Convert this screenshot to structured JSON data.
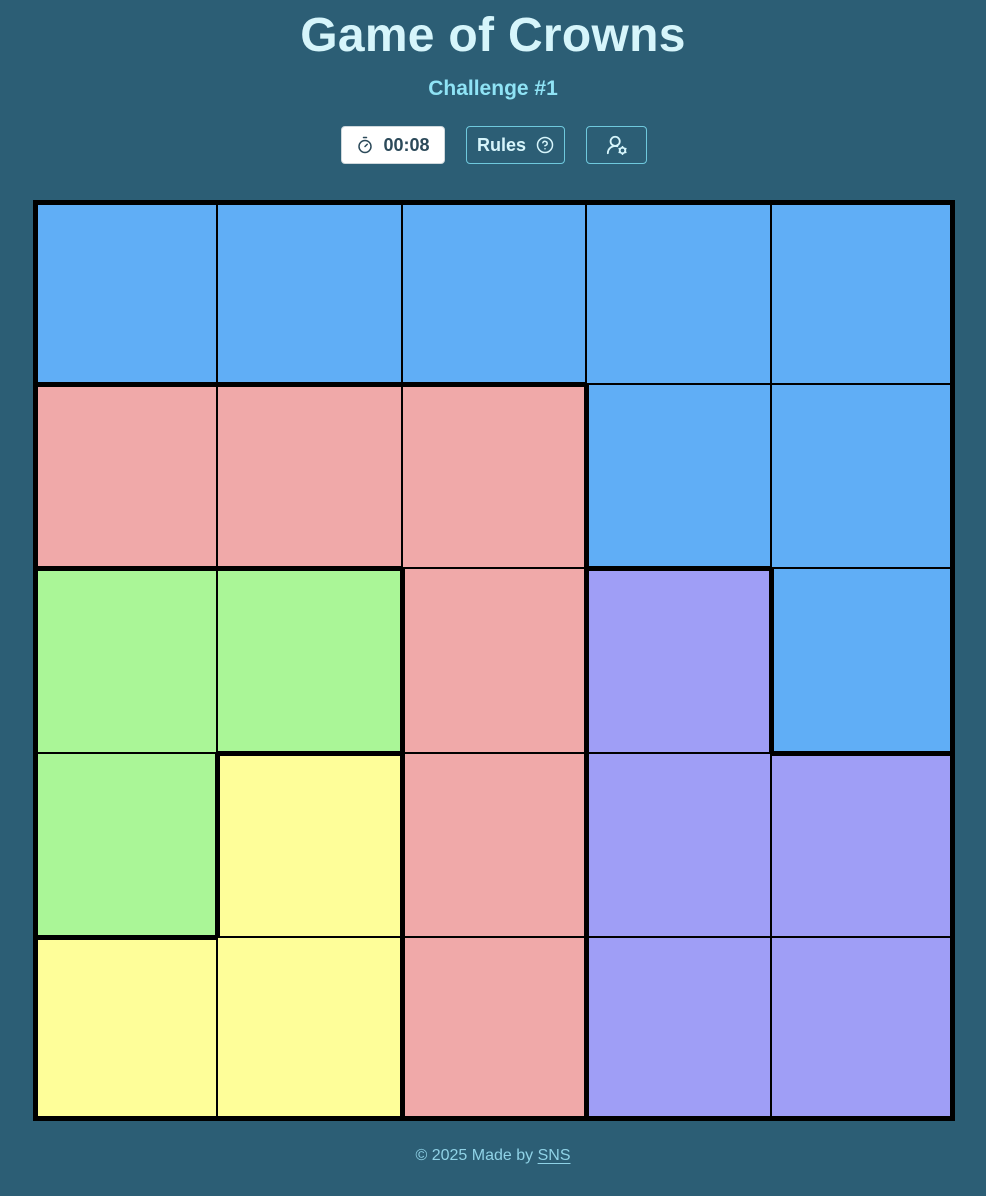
{
  "header": {
    "title": "Game of Crowns",
    "subtitle": "Challenge #1"
  },
  "toolbar": {
    "timer_value": "00:08",
    "timer_icon": "stopwatch-icon",
    "rules_label": "Rules",
    "rules_icon": "help-circle-icon",
    "settings_icon": "user-settings-icon"
  },
  "board": {
    "size": 5,
    "region_colors": {
      "blue": "#60aef6",
      "red": "#f0a9a9",
      "green": "#aaf697",
      "yellow": "#fefe99",
      "purple": "#9f9ef6"
    },
    "rows": [
      [
        "blue",
        "blue",
        "blue",
        "blue",
        "blue"
      ],
      [
        "red",
        "red",
        "red",
        "blue",
        "blue"
      ],
      [
        "green",
        "green",
        "red",
        "purple",
        "blue"
      ],
      [
        "green",
        "yellow",
        "red",
        "purple",
        "purple"
      ],
      [
        "yellow",
        "yellow",
        "red",
        "purple",
        "purple"
      ]
    ]
  },
  "footer": {
    "copyright": "© 2025 Made by",
    "author_link": "SNS"
  }
}
